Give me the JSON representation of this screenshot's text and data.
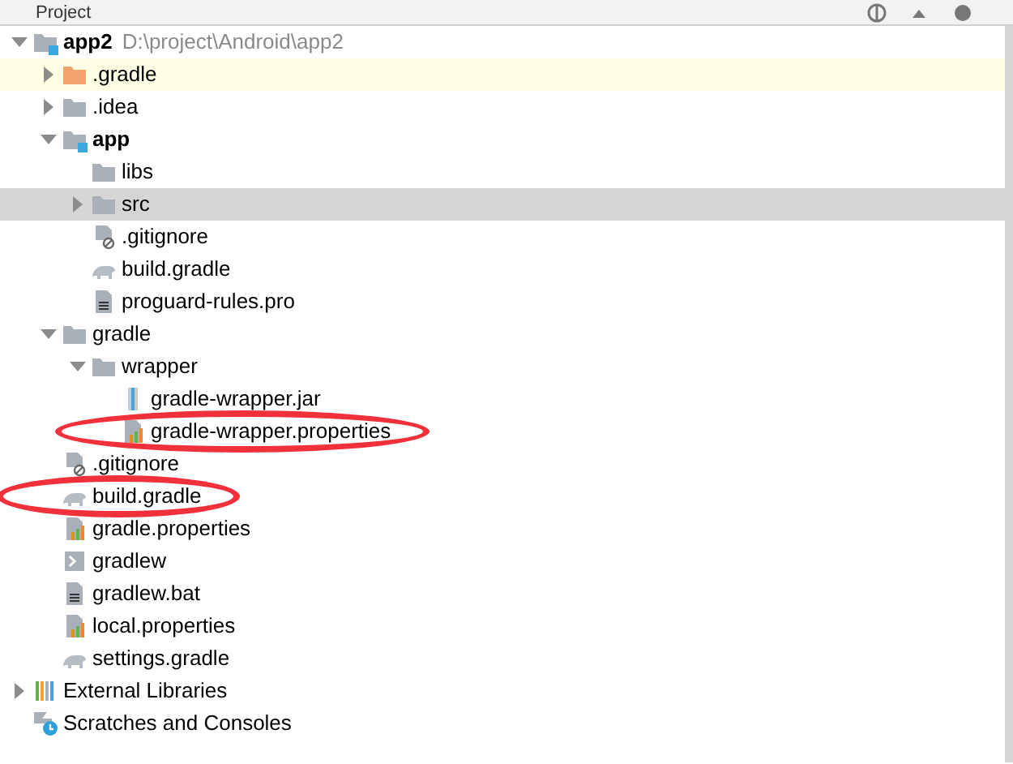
{
  "panel": {
    "title": "Project"
  },
  "tree": [
    {
      "label": "app2",
      "kind": "module",
      "path": "D:\\project\\Android\\app2",
      "expanded": true,
      "selected": false,
      "highlighted": false,
      "circled": false,
      "children": [
        {
          "label": ".gradle",
          "kind": "excluded",
          "expanded": false,
          "selected": false,
          "highlighted": true,
          "circled": false
        },
        {
          "label": ".idea",
          "kind": "folder",
          "expanded": false,
          "selected": false,
          "highlighted": false,
          "circled": false
        },
        {
          "label": "app",
          "kind": "module",
          "expanded": true,
          "selected": false,
          "highlighted": false,
          "circled": false,
          "children": [
            {
              "label": "libs",
              "kind": "folder",
              "selected": false,
              "highlighted": false,
              "circled": false
            },
            {
              "label": "src",
              "kind": "folder",
              "expanded": false,
              "selected": true,
              "highlighted": false,
              "circled": false
            },
            {
              "label": ".gitignore",
              "kind": "ignore",
              "selected": false,
              "highlighted": false,
              "circled": false
            },
            {
              "label": "build.gradle",
              "kind": "gradle",
              "selected": false,
              "highlighted": false,
              "circled": false
            },
            {
              "label": "proguard-rules.pro",
              "kind": "text",
              "selected": false,
              "highlighted": false,
              "circled": false
            }
          ]
        },
        {
          "label": "gradle",
          "kind": "folder",
          "expanded": true,
          "selected": false,
          "highlighted": false,
          "circled": false,
          "children": [
            {
              "label": "wrapper",
              "kind": "folder",
              "expanded": true,
              "selected": false,
              "highlighted": false,
              "circled": false,
              "children": [
                {
                  "label": "gradle-wrapper.jar",
                  "kind": "jar",
                  "selected": false,
                  "highlighted": false,
                  "circled": false
                },
                {
                  "label": "gradle-wrapper.properties",
                  "kind": "properties",
                  "selected": false,
                  "highlighted": false,
                  "circled": true
                }
              ]
            }
          ]
        },
        {
          "label": ".gitignore",
          "kind": "ignore",
          "selected": false,
          "highlighted": false,
          "circled": false
        },
        {
          "label": "build.gradle",
          "kind": "gradle",
          "selected": false,
          "highlighted": false,
          "circled": true
        },
        {
          "label": "gradle.properties",
          "kind": "properties",
          "selected": false,
          "highlighted": false,
          "circled": false
        },
        {
          "label": "gradlew",
          "kind": "shell",
          "selected": false,
          "highlighted": false,
          "circled": false
        },
        {
          "label": "gradlew.bat",
          "kind": "text",
          "selected": false,
          "highlighted": false,
          "circled": false
        },
        {
          "label": "local.properties",
          "kind": "properties",
          "selected": false,
          "highlighted": false,
          "circled": false
        },
        {
          "label": "settings.gradle",
          "kind": "gradle",
          "selected": false,
          "highlighted": false,
          "circled": false
        }
      ]
    },
    {
      "label": "External Libraries",
      "kind": "libraries",
      "expanded": false,
      "selected": false,
      "highlighted": false,
      "circled": false
    },
    {
      "label": "Scratches and Consoles",
      "kind": "scratches",
      "selected": false,
      "highlighted": false,
      "circled": false
    }
  ]
}
